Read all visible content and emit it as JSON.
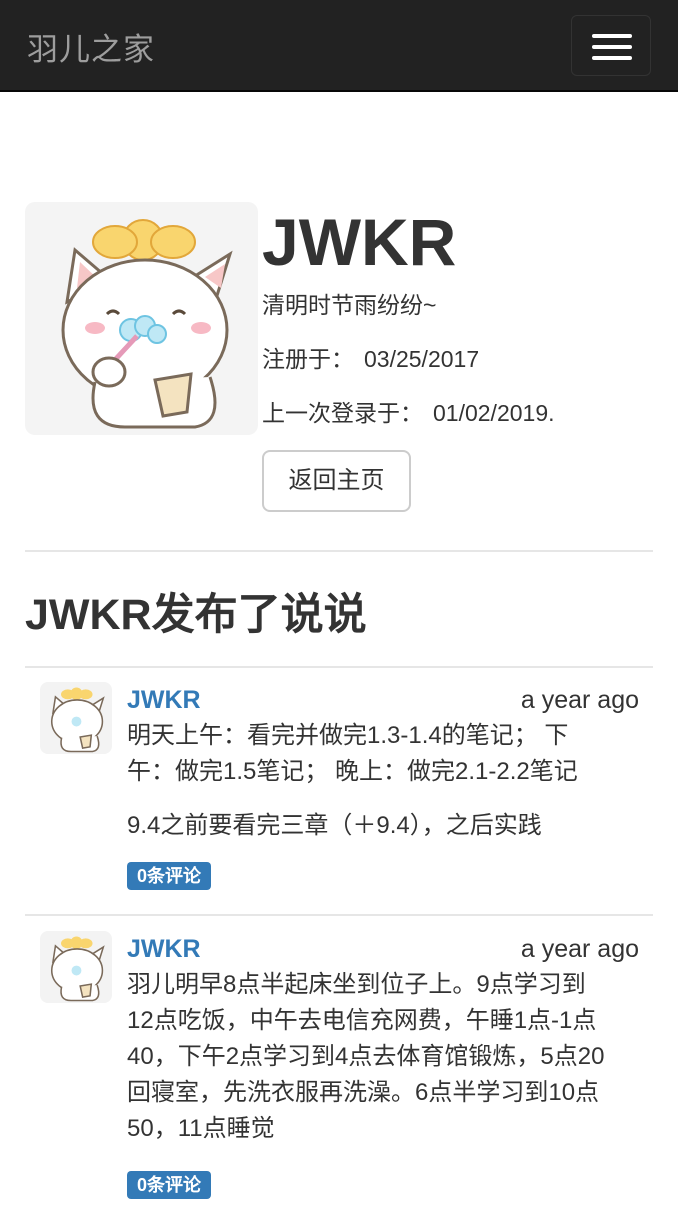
{
  "navbar": {
    "brand": "羽儿之家",
    "toggle_icon": "hamburger-menu-icon"
  },
  "profile": {
    "username": "JWKR",
    "bio": "清明时节雨纷纷~",
    "registered_label": "注册于：",
    "registered_date": "03/25/2017",
    "last_login_label": "上一次登录于：",
    "last_login_date": "01/02/2019.",
    "home_button": "返回主页"
  },
  "posts_section": {
    "title": "JWKR发布了说说",
    "posts": [
      {
        "author": "JWKR",
        "time": "a year ago",
        "lines": [
          "明天上午：看完并做完1.3-1.4的笔记；  下",
          "午：做完1.5笔记；  晚上：做完2.1-2.2笔记",
          "9.4之前要看完三章（＋9.4），之后实践"
        ],
        "comments": "0条评论"
      },
      {
        "author": "JWKR",
        "time": "a year ago",
        "lines": [
          "羽儿明早8点半起床坐到位子上。9点学习到",
          "12点吃饭，中午去电信充网费，午睡1点-1点",
          "40，下午2点学习到4点去体育馆锻炼，5点20",
          "回寝室，先洗衣服再洗澡。6点半学习到10点",
          "50，11点睡觉"
        ],
        "comments": "0条评论"
      }
    ]
  }
}
